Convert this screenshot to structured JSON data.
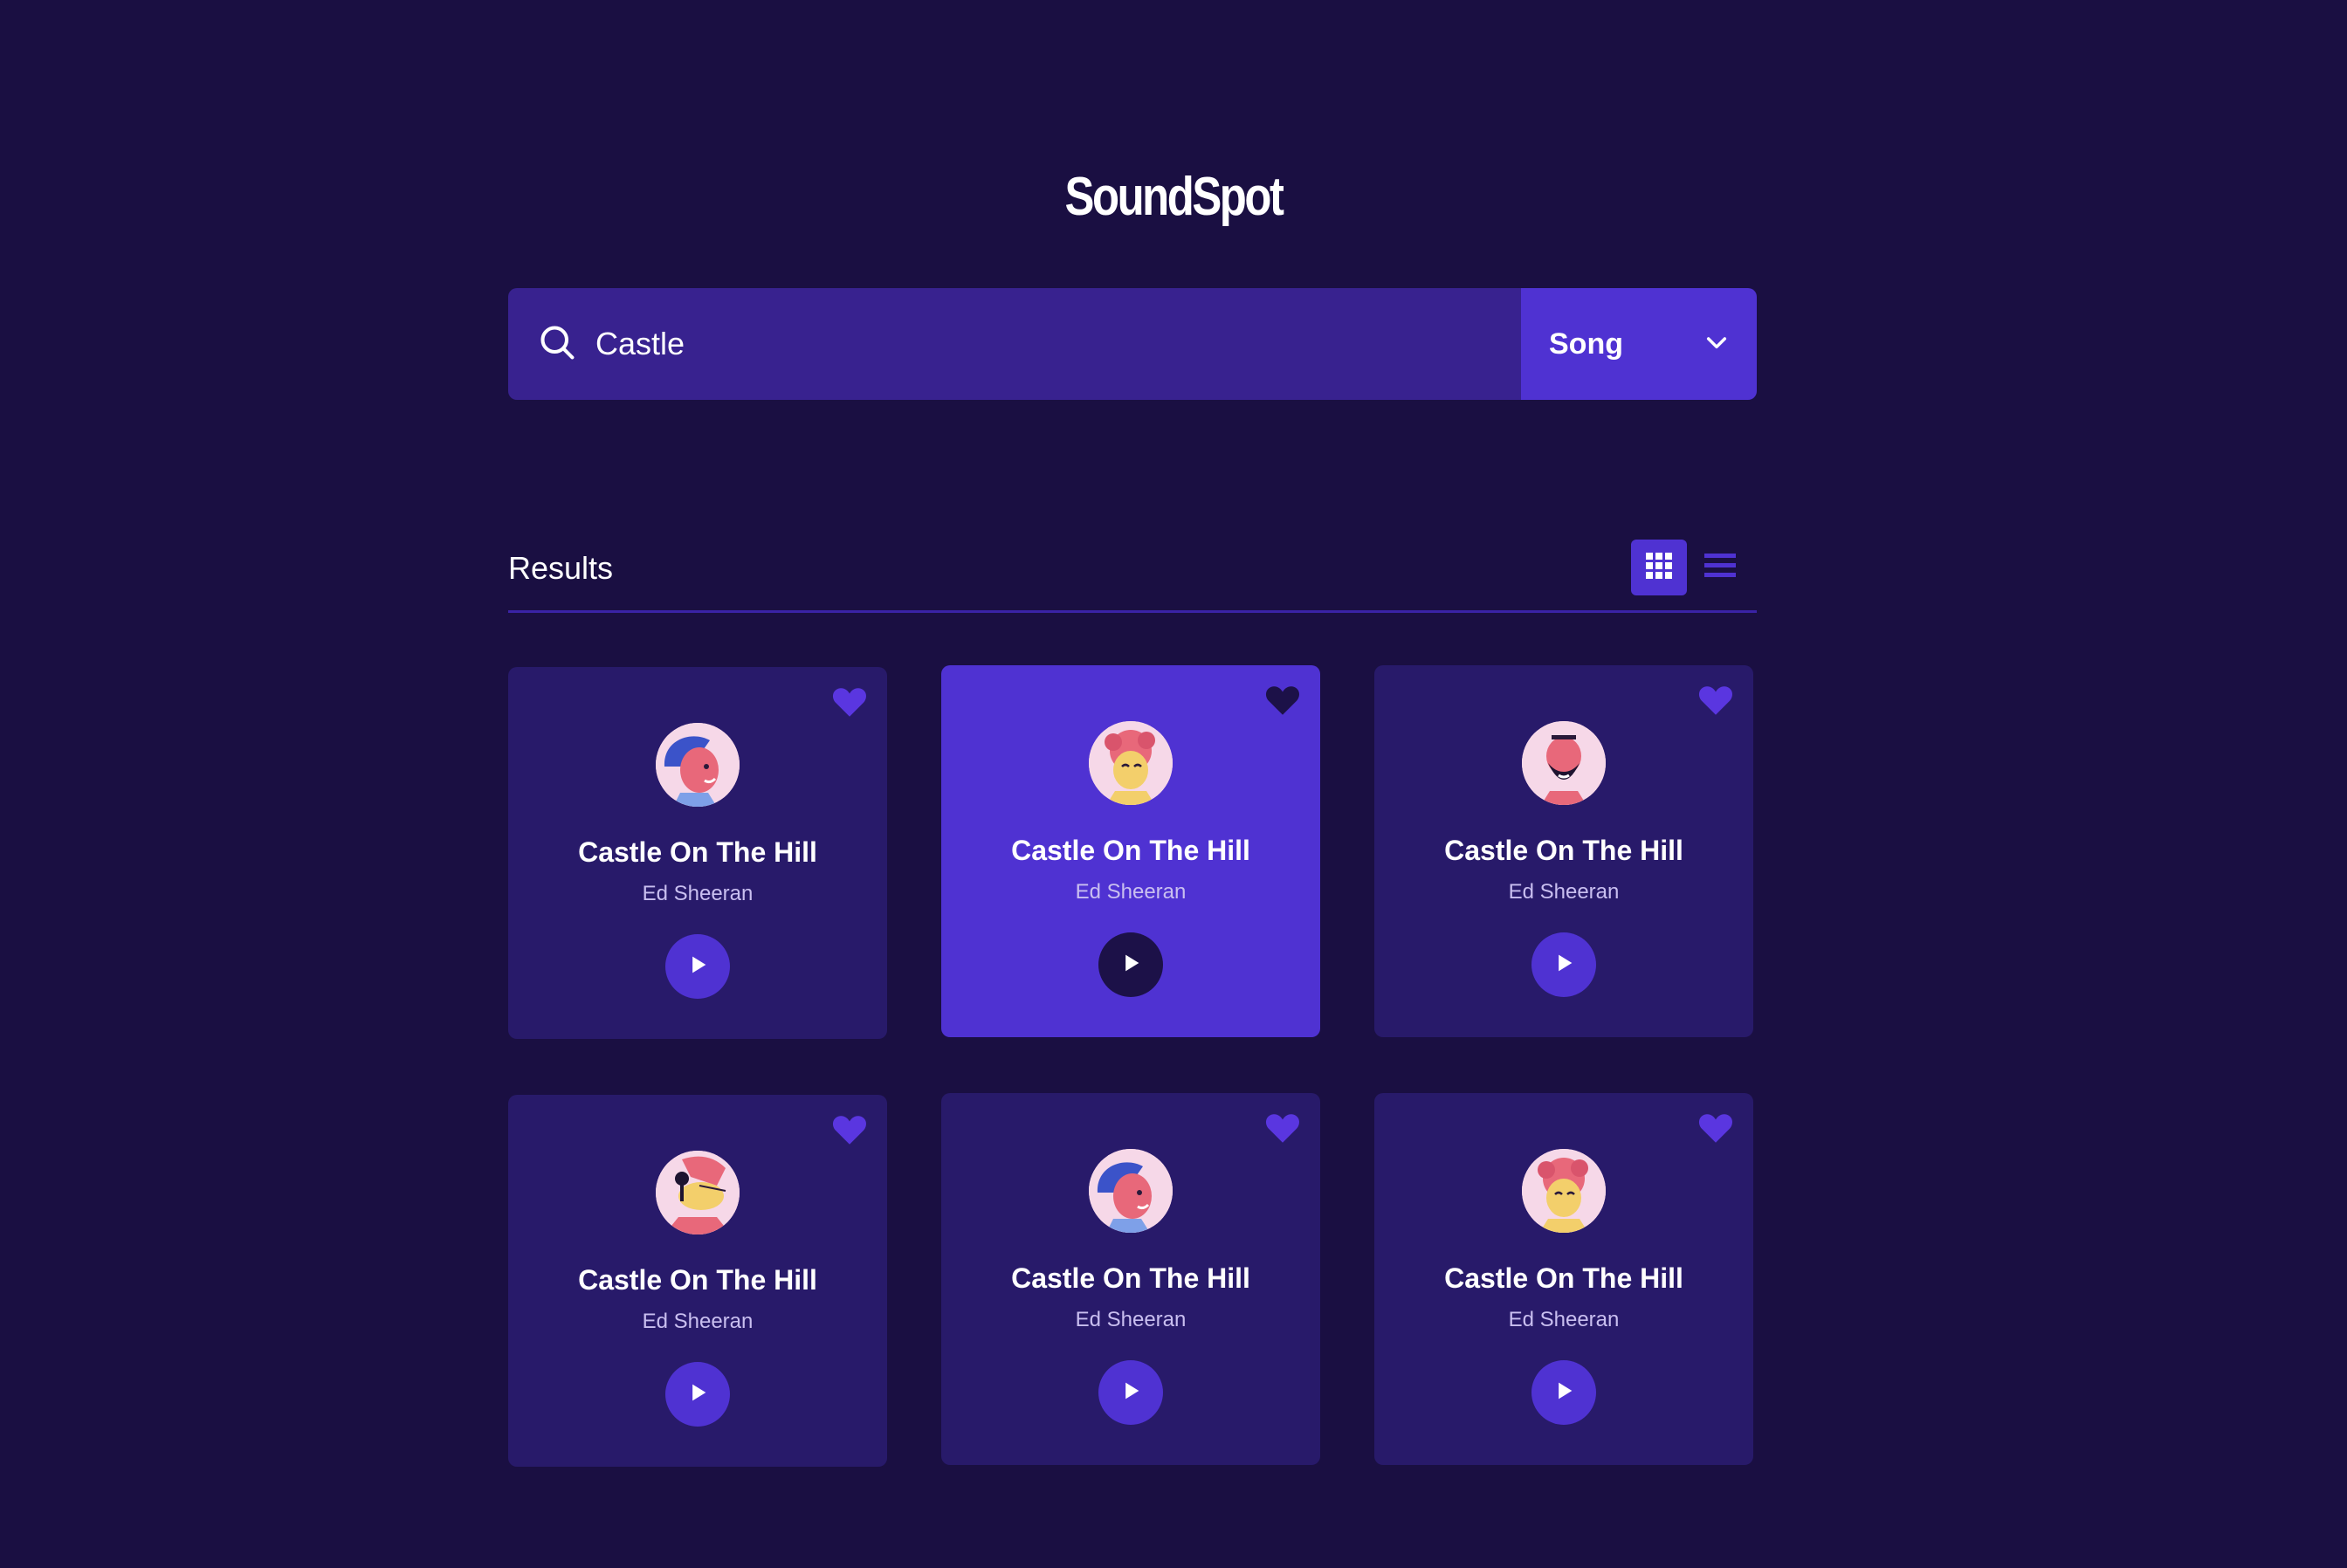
{
  "app": {
    "logo": "SoundSpot"
  },
  "search": {
    "query": "Castle",
    "placeholder": "",
    "type_selected": "Song"
  },
  "results": {
    "title": "Results",
    "view_mode": "grid",
    "items": [
      {
        "title": "Castle On The Hill",
        "artist": "Ed Sheeran",
        "avatar": "woman-blue-hair-avatar",
        "active": false
      },
      {
        "title": "Castle On The Hill",
        "artist": "Ed Sheeran",
        "avatar": "woman-pink-curly-hair-avatar",
        "active": true
      },
      {
        "title": "Castle On The Hill",
        "artist": "Ed Sheeran",
        "avatar": "bearded-man-avatar",
        "active": false
      },
      {
        "title": "Castle On The Hill",
        "artist": "Ed Sheeran",
        "avatar": "singer-with-microphone-avatar",
        "active": false
      },
      {
        "title": "Castle On The Hill",
        "artist": "Ed Sheeran",
        "avatar": "woman-blue-hair-avatar",
        "active": false
      },
      {
        "title": "Castle On The Hill",
        "artist": "Ed Sheeran",
        "avatar": "woman-pink-curly-hair-avatar",
        "active": false
      }
    ]
  },
  "colors": {
    "background": "#1a0f42",
    "card": "#281a6a",
    "accent": "#4f32d2",
    "search_field": "#38228f"
  }
}
